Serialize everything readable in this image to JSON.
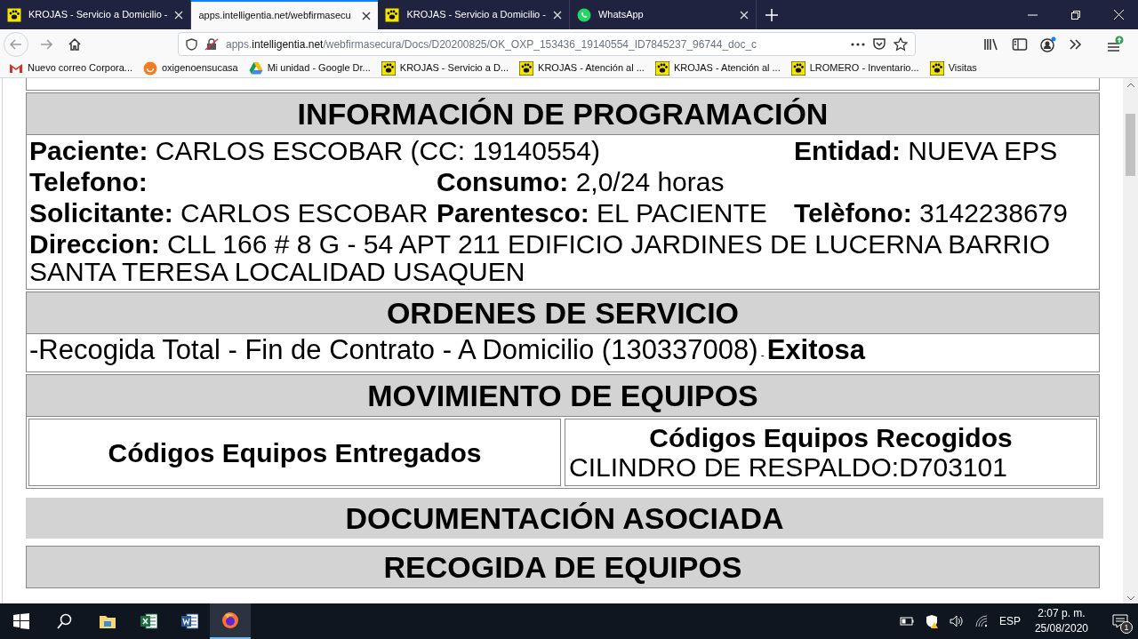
{
  "browser": {
    "tabs": [
      {
        "title": "KROJAS - Servicio a Domicilio -",
        "kind": "paw",
        "selected": false
      },
      {
        "title": "apps.intelligentia.net/webfirmasecu",
        "kind": "none",
        "selected": true
      },
      {
        "title": "KROJAS - Servicio a Domicilio -",
        "kind": "paw",
        "selected": false
      },
      {
        "title": "WhatsApp",
        "kind": "chat",
        "selected": false
      }
    ],
    "url": {
      "host_prefix": "apps.",
      "host": "intelligentia.net",
      "path": "/webfirmasecura/Docs/D20200825/OK_OXP_153436_19140554_ID7845237_96744_doc_c"
    },
    "bookmarks": [
      {
        "title": "Nuevo correo Corpora...",
        "kind": "mail"
      },
      {
        "title": "oxigenoensucasa",
        "kind": "smile"
      },
      {
        "title": "Mi unidad - Google Dr...",
        "kind": "drive"
      },
      {
        "title": "KROJAS - Servicio a D...",
        "kind": "paw"
      },
      {
        "title": "KROJAS - Atención al ...",
        "kind": "paw"
      },
      {
        "title": "KROJAS - Atención al ...",
        "kind": "paw"
      },
      {
        "title": "LROMERO - Inventario...",
        "kind": "paw"
      },
      {
        "title": "Visitas",
        "kind": "paw"
      }
    ]
  },
  "document": {
    "programacion": {
      "heading": "INFORMACIÓN DE PROGRAMACIÓN",
      "rows": [
        [
          {
            "label": "Paciente:",
            "value": "CARLOS ESCOBAR (CC: 19140554)"
          },
          "",
          {
            "label": "Entidad:",
            "value": "NUEVA EPS"
          }
        ],
        [
          {
            "label": "Telefono:"
          },
          {
            "label": "Consumo:",
            "value": "2,0/24 horas"
          }
        ],
        [
          {
            "label": "Solicitante:",
            "value": "CARLOS ESCOBAR"
          },
          {
            "label": "Parentesco:",
            "value": "EL PACIENTE"
          },
          {
            "label": "Telèfono:",
            "value": "3142238679"
          }
        ],
        [
          {
            "label": "Direccion:",
            "value": "CLL 166 # 8 G - 54 APT 211 EDIFICIO JARDINES DE LUCERNA BARRIO SANTA TERESA LOCALIDAD USAQUEN"
          }
        ]
      ]
    },
    "ordenes": {
      "heading": "ORDENES DE SERVICIO",
      "items": [
        {
          "description": "-Recogida Total - Fin de Contrato - A Domicilio (130337008)",
          "separator": "-",
          "status": "Exitosa"
        }
      ]
    },
    "movimiento": {
      "heading": "MOVIMIENTO DE EQUIPOS",
      "columns": [
        {
          "heading": "Códigos Equipos Entregados"
        },
        {
          "heading": "Códigos Equipos Recogidos",
          "items": [
            "CILINDRO DE RESPALDO:D703101"
          ]
        }
      ]
    },
    "documentacion": {
      "heading": "DOCUMENTACIÓN ASOCIADA"
    },
    "recogida": {
      "heading": "RECOGIDA DE EQUIPOS"
    }
  },
  "taskbar": {
    "apps": [
      {
        "kind": "folder",
        "selected": false
      },
      {
        "kind": "excel",
        "selected": false
      },
      {
        "kind": "word",
        "selected": false
      },
      {
        "kind": "firefox",
        "selected": true
      }
    ],
    "language": "ESP",
    "time": "2:07 p. m.",
    "date": "25/08/2020",
    "notifications": "1"
  }
}
